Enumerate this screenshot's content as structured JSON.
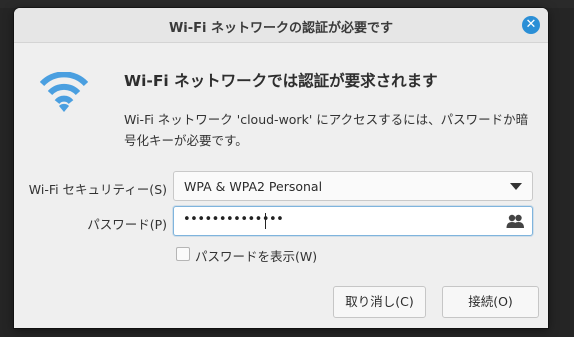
{
  "window": {
    "title": "Wi-Fi ネットワークの認証が必要です",
    "close_icon": "close-icon",
    "accent_color": "#2b8fd6"
  },
  "header": {
    "icon": "wifi-icon",
    "heading": "Wi-Fi ネットワークでは認証が要求されます",
    "description": "Wi-Fi ネットワーク 'cloud-work' にアクセスするには、パスワードか暗号化キーが必要です。"
  },
  "form": {
    "security_label": "Wi-Fi セキュリティー(S)",
    "security_value": "WPA & WPA2 Personal",
    "password_label": "パスワード(P)",
    "password_masked": "••••••••••••••",
    "password_icon": "users-icon",
    "show_password_label": "パスワードを表示(W)",
    "show_password_checked": false
  },
  "buttons": {
    "cancel": "取り消し(C)",
    "connect": "接続(O)"
  }
}
